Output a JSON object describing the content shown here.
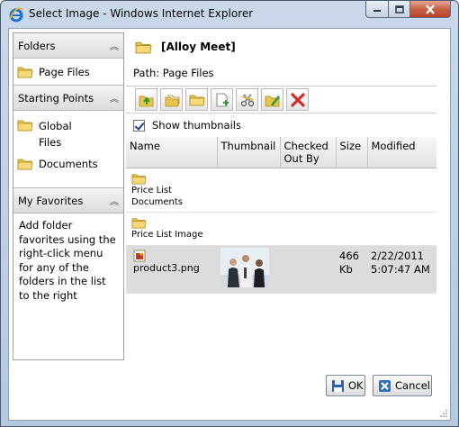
{
  "window": {
    "title": "Select Image - Windows Internet Explorer"
  },
  "left_panel": {
    "folders_header": "Folders",
    "folders": [
      {
        "label": "Page Files"
      }
    ],
    "starting_points_header": "Starting Points",
    "starting_points": [
      {
        "label": "Global Files"
      },
      {
        "label": "Documents"
      }
    ],
    "favorites_header": "My Favorites",
    "favorites_text": "Add folder favorites using the right-click menu for any of the folders in the list to the right"
  },
  "right_panel": {
    "title": "[Alloy Meet]",
    "path": "Path: Page Files",
    "show_thumbnails_label": "Show thumbnails",
    "columns": [
      "Name",
      "Thumbnail",
      "Checked Out By",
      "Size",
      "Modified"
    ],
    "rows": [
      {
        "name": "Price List Documents",
        "type": "folder"
      },
      {
        "name": "Price List Image",
        "type": "folder"
      },
      {
        "name": "product3.png",
        "type": "file",
        "size": "466 Kb",
        "modified": "2/22/2011 5:07:47 AM"
      }
    ]
  },
  "buttons": {
    "ok": "OK",
    "cancel": "Cancel"
  },
  "icons": [
    "ie-icon",
    "minimize-icon",
    "maximize-icon",
    "close-icon",
    "folder-icon",
    "chevron-up-icon",
    "png-file-icon",
    "save-icon",
    "cancel-icon"
  ],
  "colors": {
    "selected_row": "#dcdcdc",
    "folder": "#e8c44a",
    "delete": "#d42a2a"
  }
}
